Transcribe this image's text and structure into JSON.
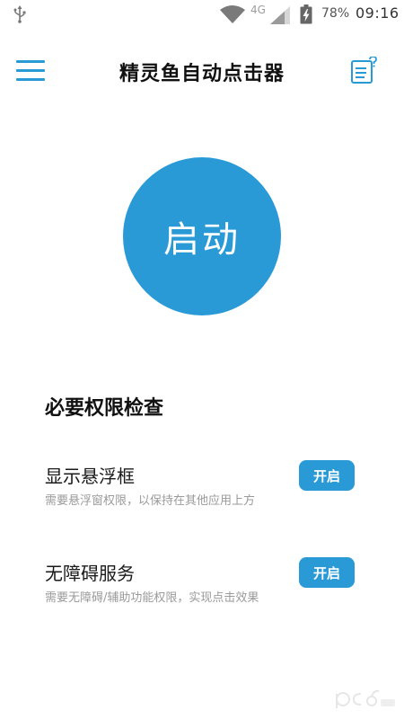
{
  "status_bar": {
    "network_type": "4G",
    "battery_percent": "78%",
    "time": "09:16"
  },
  "app_bar": {
    "title": "精灵鱼自动点击器",
    "menu_icon": "hamburger-menu-icon",
    "help_icon": "help-document-icon"
  },
  "start_button": {
    "label": "启动"
  },
  "permissions": {
    "section_title": "必要权限检查",
    "items": [
      {
        "title": "显示悬浮框",
        "description": "需要悬浮窗权限，以保持在其他应用上方",
        "button_label": "开启"
      },
      {
        "title": "无障碍服务",
        "description": "需要无障碍/辅助功能权限，实现点击效果",
        "button_label": "开启"
      }
    ]
  },
  "colors": {
    "accent": "#2a9ad7",
    "text_primary": "#111111",
    "text_secondary": "#9a9a9a"
  }
}
